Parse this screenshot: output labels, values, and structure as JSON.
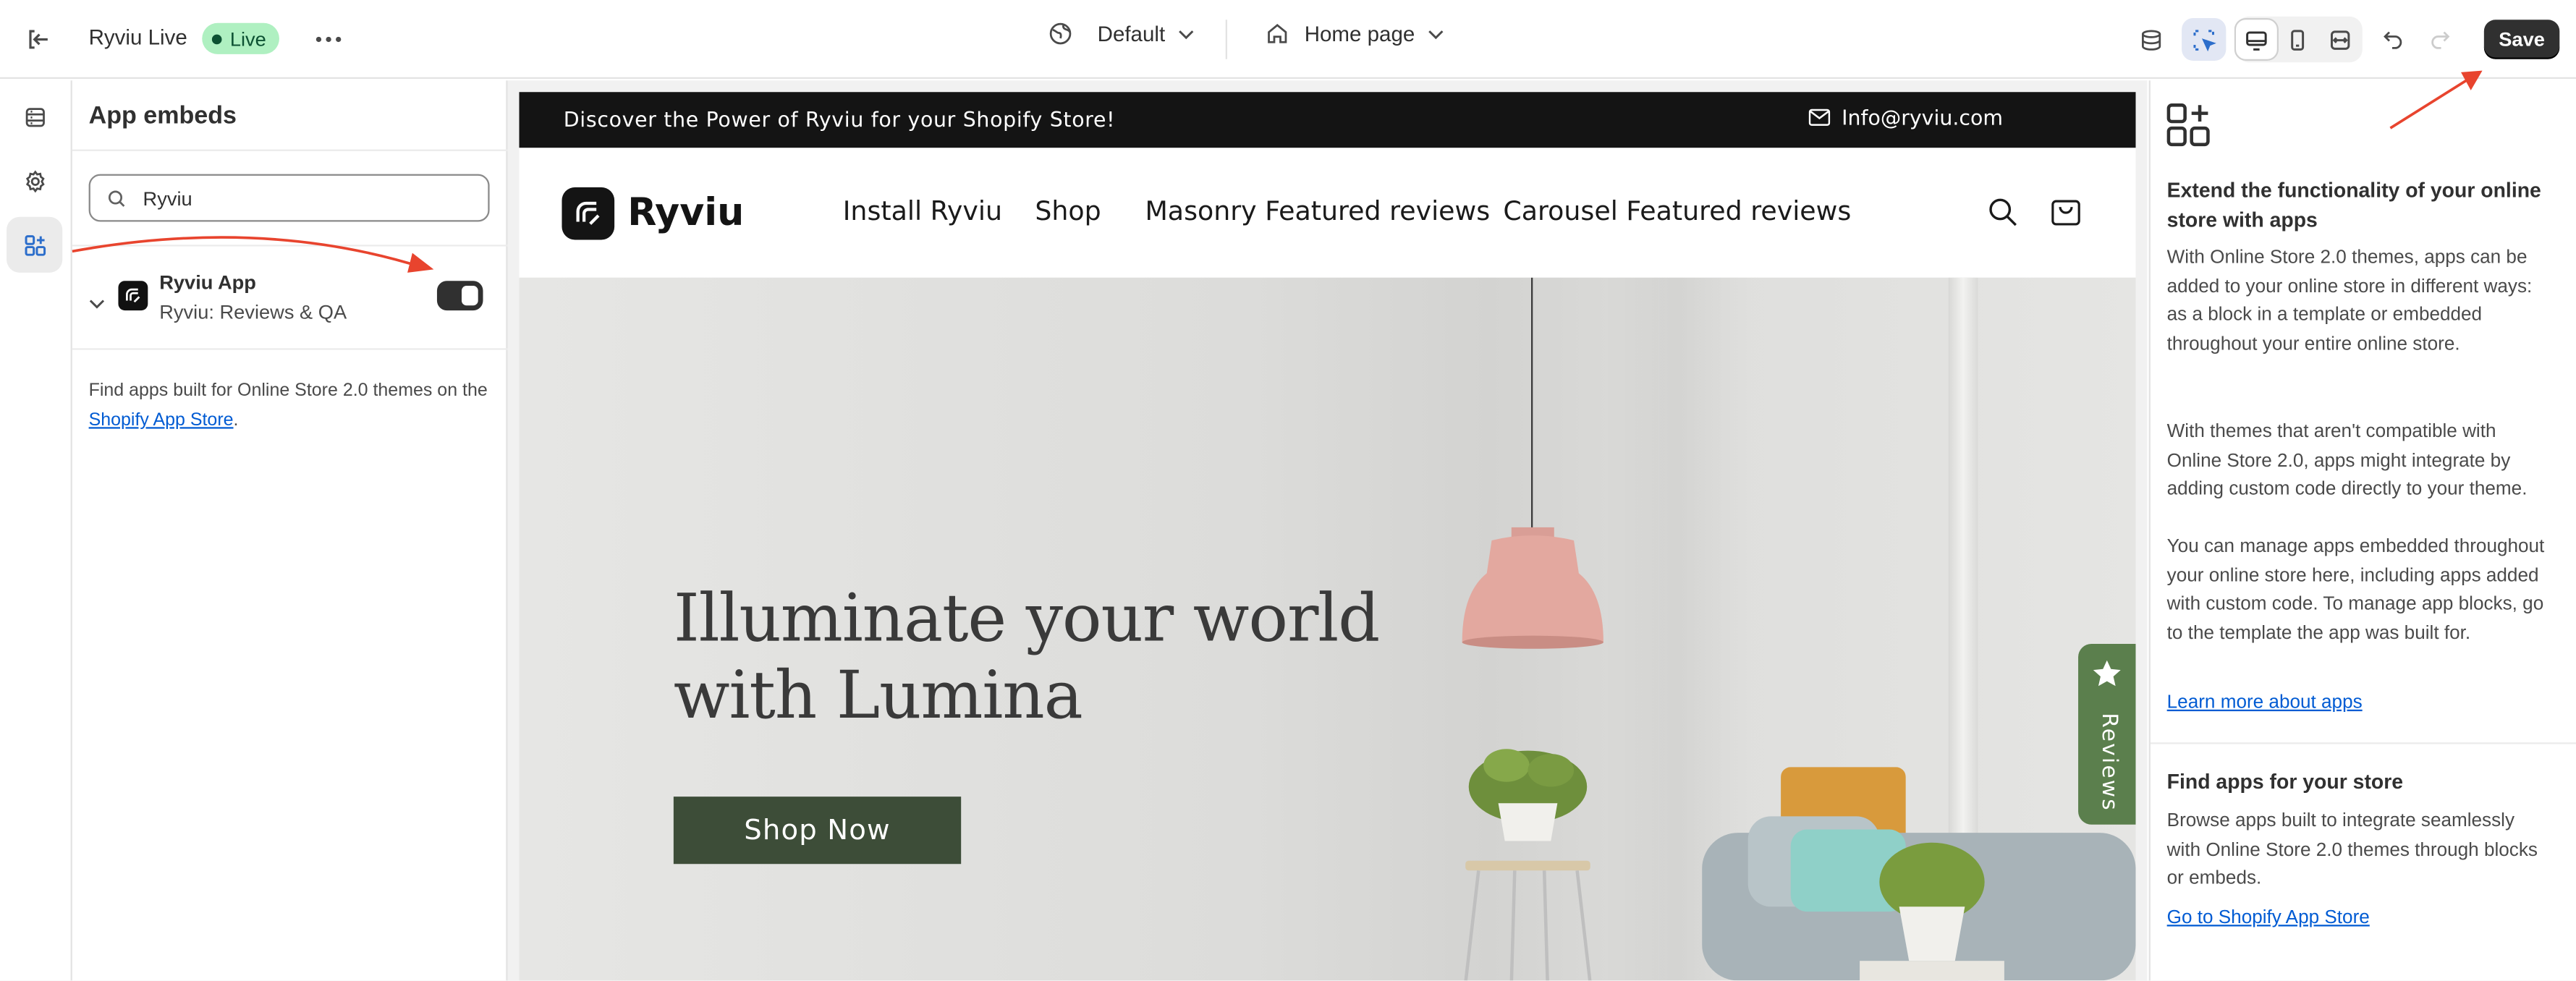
{
  "topbar": {
    "store_name": "Ryviu Live",
    "status_badge": "Live",
    "theme_dropdown": "Default",
    "page_dropdown": "Home page",
    "save_label": "Save"
  },
  "panel": {
    "title": "App embeds",
    "search_value": "Ryviu",
    "app": {
      "name": "Ryviu App",
      "subtitle": "Ryviu: Reviews & QA",
      "enabled": true
    },
    "find_text": "Find apps built for Online Store 2.0 themes on the",
    "find_link": "Shopify App Store",
    "find_suffix": "."
  },
  "preview": {
    "announcement": "Discover the Power of Ryviu for your Shopify Store!",
    "email": "Info@ryviu.com",
    "logo_text": "Ryviu",
    "nav": [
      "Install Ryviu",
      "Shop",
      "Masonry Featured reviews",
      "Carousel Featured reviews"
    ],
    "hero_title_line1": "Illuminate your world",
    "hero_title_line2": "with Lumina",
    "hero_button": "Shop Now",
    "reviews_tab": "Reviews"
  },
  "sidebar": {
    "heading": "Extend the functionality of your online store with apps",
    "para1": "With Online Store 2.0 themes, apps can be added to your online store in different ways: as a block in a template or embedded throughout your entire online store.",
    "para2": "With themes that aren't compatible with Online Store 2.0, apps might integrate by adding custom code directly to your theme.",
    "para3": "You can manage apps embedded throughout your online store here, including apps added with custom code. To manage app blocks, go to the template the app was built for.",
    "learn_link": "Learn more about apps",
    "find_heading": "Find apps for your store",
    "find_para": "Browse apps built to integrate seamlessly with Online Store 2.0 themes through blocks or embeds.",
    "store_link": "Go to Shopify App Store"
  },
  "colors": {
    "live_badge_bg": "#aff0c1",
    "save_bg": "#303030",
    "link": "#005bd3",
    "shop_now_bg": "#3d4d38",
    "reviews_tab_bg": "#5b7f4d",
    "annotation_arrow": "#e8442e"
  }
}
